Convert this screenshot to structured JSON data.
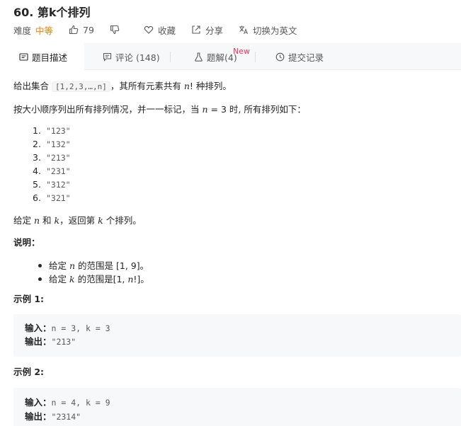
{
  "problem": {
    "title": "60. 第k个排列",
    "difficulty_label": "难度",
    "difficulty": "中等",
    "likes": "79",
    "favorite_label": "收藏",
    "share_label": "分享",
    "translate_label": "切换为英文"
  },
  "tabs": [
    {
      "label": "题目描述"
    },
    {
      "label": "评论 (148)"
    },
    {
      "label": "题解(4)"
    },
    {
      "label": "提交记录"
    }
  ],
  "new_badge": "New",
  "description": {
    "p1_a": "给出集合",
    "p1_code": "[1,2,3,…,n]",
    "p1_b": "，其所有元素共有",
    "p1_var": "n",
    "p1_c": "! 种排列。",
    "p2_a": "按大小顺序列出所有排列情况，并一一标记，当",
    "p2_var": "n",
    "p2_b": "= 3 时, 所有排列如下：",
    "list": [
      {
        "num": "1.",
        "value": "\"123\""
      },
      {
        "num": "2.",
        "value": "\"132\""
      },
      {
        "num": "3.",
        "value": "\"213\""
      },
      {
        "num": "4.",
        "value": "\"231\""
      },
      {
        "num": "5.",
        "value": "\"312\""
      },
      {
        "num": "6.",
        "value": "\"321\""
      }
    ],
    "p3_a": "给定",
    "p3_n": "n",
    "p3_b": "和",
    "p3_k": "k",
    "p3_c": "，返回第",
    "p3_k2": "k",
    "p3_d": "个排列。",
    "note_heading": "说明：",
    "note1_a": "给定",
    "note1_var": "n",
    "note1_b": "的范围是 [1, 9]。",
    "note2_a": "给定",
    "note2_var": "k",
    "note2_b": "的范围是[1,",
    "note2_var2": "n",
    "note2_c": "!]。"
  },
  "examples": [
    {
      "heading": "示例 1:",
      "input_label": "输入：",
      "input": "n = 3, k = 3",
      "output_label": "输出：",
      "output": "\"213\""
    },
    {
      "heading": "示例 2:",
      "input_label": "输入：",
      "input": "n = 4, k = 9",
      "output_label": "输出：",
      "output": "\"2314\""
    }
  ]
}
